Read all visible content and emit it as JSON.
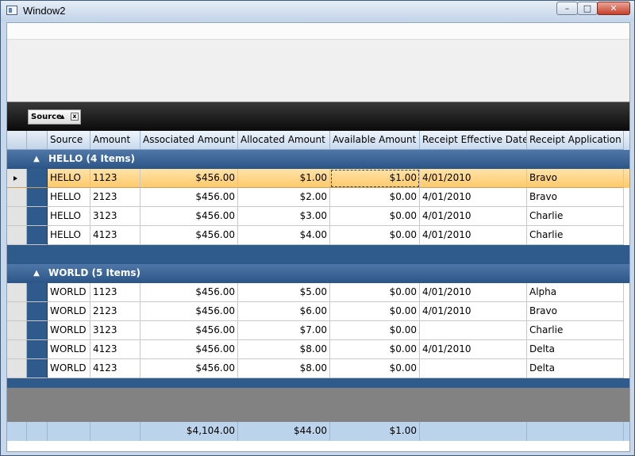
{
  "window": {
    "title": "Window2",
    "caption_buttons": {
      "minimize": "–",
      "maximize": "□",
      "close": "✕"
    }
  },
  "group_panel": {
    "chip_label": "Source",
    "sort_icon": "sort-ascending-icon",
    "sort_glyph": "▲",
    "remove_glyph": "x"
  },
  "columns": [
    "Source",
    "Amount",
    "Associated Amount",
    "Allocated Amount",
    "Available Amount",
    "Receipt Effective Date",
    "Receipt Application"
  ],
  "groups": [
    {
      "title": "HELLO (4 Items)",
      "expander_glyph": "▲",
      "rows": [
        {
          "source": "HELLO",
          "amount": "1123",
          "associated": "$456.00",
          "allocated": "$1.00",
          "available": "$1.00",
          "date": "4/01/2010",
          "application": "Bravo"
        },
        {
          "source": "HELLO",
          "amount": "2123",
          "associated": "$456.00",
          "allocated": "$2.00",
          "available": "$0.00",
          "date": "4/01/2010",
          "application": "Bravo"
        },
        {
          "source": "HELLO",
          "amount": "3123",
          "associated": "$456.00",
          "allocated": "$3.00",
          "available": "$0.00",
          "date": "4/01/2010",
          "application": "Charlie"
        },
        {
          "source": "HELLO",
          "amount": "4123",
          "associated": "$456.00",
          "allocated": "$4.00",
          "available": "$0.00",
          "date": "4/01/2010",
          "application": "Charlie"
        }
      ]
    },
    {
      "title": "WORLD (5 Items)",
      "expander_glyph": "▲",
      "rows": [
        {
          "source": "WORLD",
          "amount": "1123",
          "associated": "$456.00",
          "allocated": "$5.00",
          "available": "$0.00",
          "date": "4/01/2010",
          "application": "Alpha"
        },
        {
          "source": "WORLD",
          "amount": "2123",
          "associated": "$456.00",
          "allocated": "$6.00",
          "available": "$0.00",
          "date": "4/01/2010",
          "application": "Bravo"
        },
        {
          "source": "WORLD",
          "amount": "3123",
          "associated": "$456.00",
          "allocated": "$7.00",
          "available": "$0.00",
          "date": "",
          "application": "Charlie"
        },
        {
          "source": "WORLD",
          "amount": "4123",
          "associated": "$456.00",
          "allocated": "$8.00",
          "available": "$0.00",
          "date": "4/01/2010",
          "application": "Delta"
        },
        {
          "source": "WORLD",
          "amount": "4123",
          "associated": "$456.00",
          "allocated": "$8.00",
          "available": "$0.00",
          "date": "",
          "application": "Delta"
        }
      ]
    }
  ],
  "totals": {
    "associated": "$4,104.00",
    "allocated": "$44.00",
    "available": "$1.00"
  },
  "selection": {
    "group": 0,
    "row": 0,
    "current_column": "available"
  },
  "colors": {
    "selected_row": "#ffc96a",
    "group_header": "#2b5586",
    "total_row": "#bcd3ec"
  }
}
